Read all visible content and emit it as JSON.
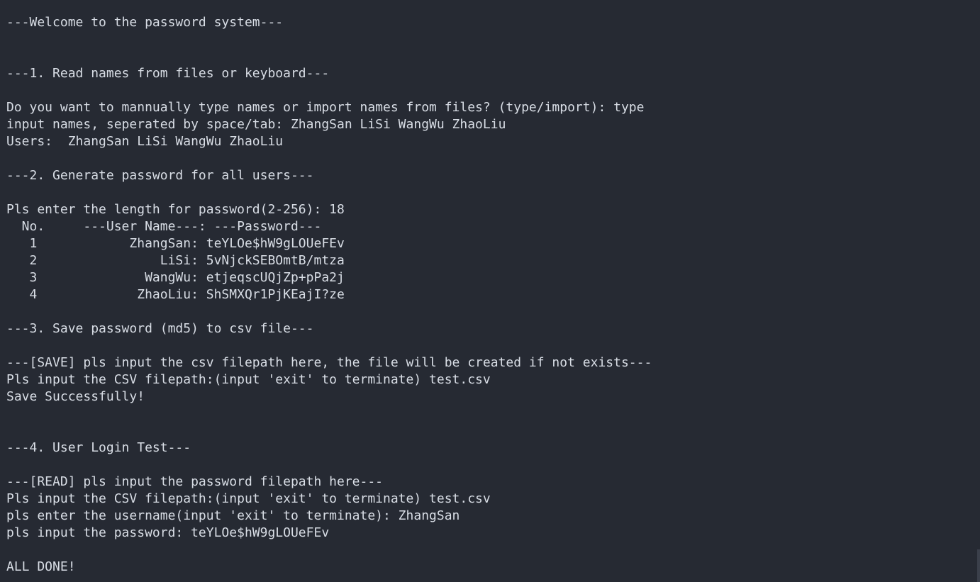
{
  "terminal": {
    "lines": [
      "---Welcome to the password system---",
      "",
      "",
      "---1. Read names from files or keyboard---",
      "",
      "Do you want to mannually type names or import names from files? (type/import): type",
      "input names, seperated by space/tab: ZhangSan LiSi WangWu ZhaoLiu",
      "Users:  ZhangSan LiSi WangWu ZhaoLiu",
      "",
      "---2. Generate password for all users---",
      "",
      "Pls enter the length for password(2-256): 18",
      "  No.     ---User Name---: ---Password---",
      "   1            ZhangSan: teYLOe$hW9gLOUeFEv",
      "   2                LiSi: 5vNjckSEBOmtB/mtza",
      "   3              WangWu: etjeqscUQjZp+pPa2j",
      "   4             ZhaoLiu: ShSMXQr1PjKEajI?ze",
      "",
      "---3. Save password (md5) to csv file---",
      "",
      "---[SAVE] pls input the csv filepath here, the file will be created if not exists---",
      "Pls input the CSV filepath:(input 'exit' to terminate) test.csv",
      "Save Successfully!",
      "",
      "",
      "---4. User Login Test---",
      "",
      "---[READ] pls input the password filepath here---",
      "Pls input the CSV filepath:(input 'exit' to terminate) test.csv",
      "pls enter the username(input 'exit' to terminate): ZhangSan",
      "pls input the password: teYLOe$hW9gLOUeFEv",
      "",
      "ALL DONE!"
    ]
  },
  "colors": {
    "background": "#262a33",
    "text": "#d8dde5"
  }
}
